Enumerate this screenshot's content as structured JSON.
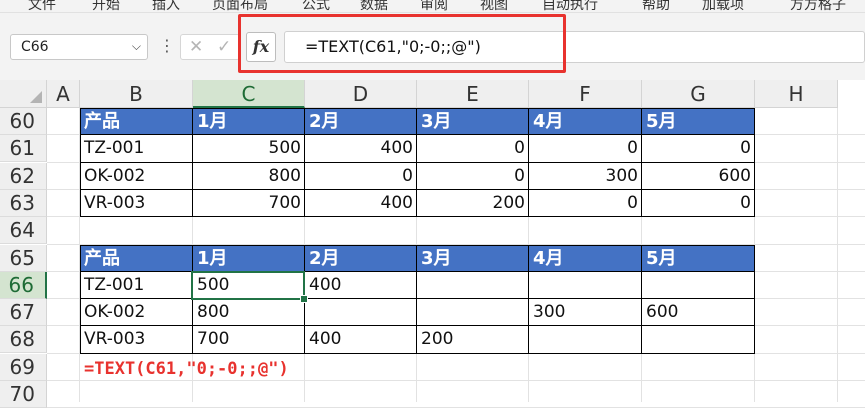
{
  "ribbon": {
    "tabs": [
      "文件",
      "开始",
      "插入",
      "页面布局",
      "公式",
      "数据",
      "审阅",
      "视图",
      "自动执行",
      "帮助",
      "加载项",
      "方方格子"
    ]
  },
  "formula_bar": {
    "name_box": "C66",
    "formula": "=TEXT(C61,\"0;-0;;@\")",
    "fx_label": "fx",
    "cancel_glyph": "✕",
    "enter_glyph": "✓",
    "more_glyph": "⋮",
    "highlight_color": "#e8322e"
  },
  "sheet": {
    "columns": [
      "A",
      "B",
      "C",
      "D",
      "E",
      "F",
      "G",
      "H"
    ],
    "selected_column": "C",
    "rows": [
      "60",
      "61",
      "62",
      "63",
      "64",
      "65",
      "66",
      "67",
      "68",
      "69",
      "70"
    ],
    "selected_row": "66",
    "active_cell": "C66",
    "table_header_color": "#4472c4"
  },
  "table1": {
    "headers": [
      "产品",
      "1月",
      "2月",
      "3月",
      "4月",
      "5月"
    ],
    "rows": [
      [
        "TZ-001",
        "500",
        "400",
        "0",
        "0",
        "0"
      ],
      [
        "OK-002",
        "800",
        "0",
        "0",
        "300",
        "600"
      ],
      [
        "VR-003",
        "700",
        "400",
        "200",
        "0",
        "0"
      ]
    ]
  },
  "table2": {
    "headers": [
      "产品",
      "1月",
      "2月",
      "3月",
      "4月",
      "5月"
    ],
    "rows": [
      [
        "TZ-001",
        "500",
        "400",
        "",
        "",
        ""
      ],
      [
        "OK-002",
        "800",
        "",
        "",
        "300",
        "600"
      ],
      [
        "VR-003",
        "700",
        "400",
        "200",
        "",
        ""
      ]
    ]
  },
  "note": "=TEXT(C61,\"0;-0;;@\")"
}
